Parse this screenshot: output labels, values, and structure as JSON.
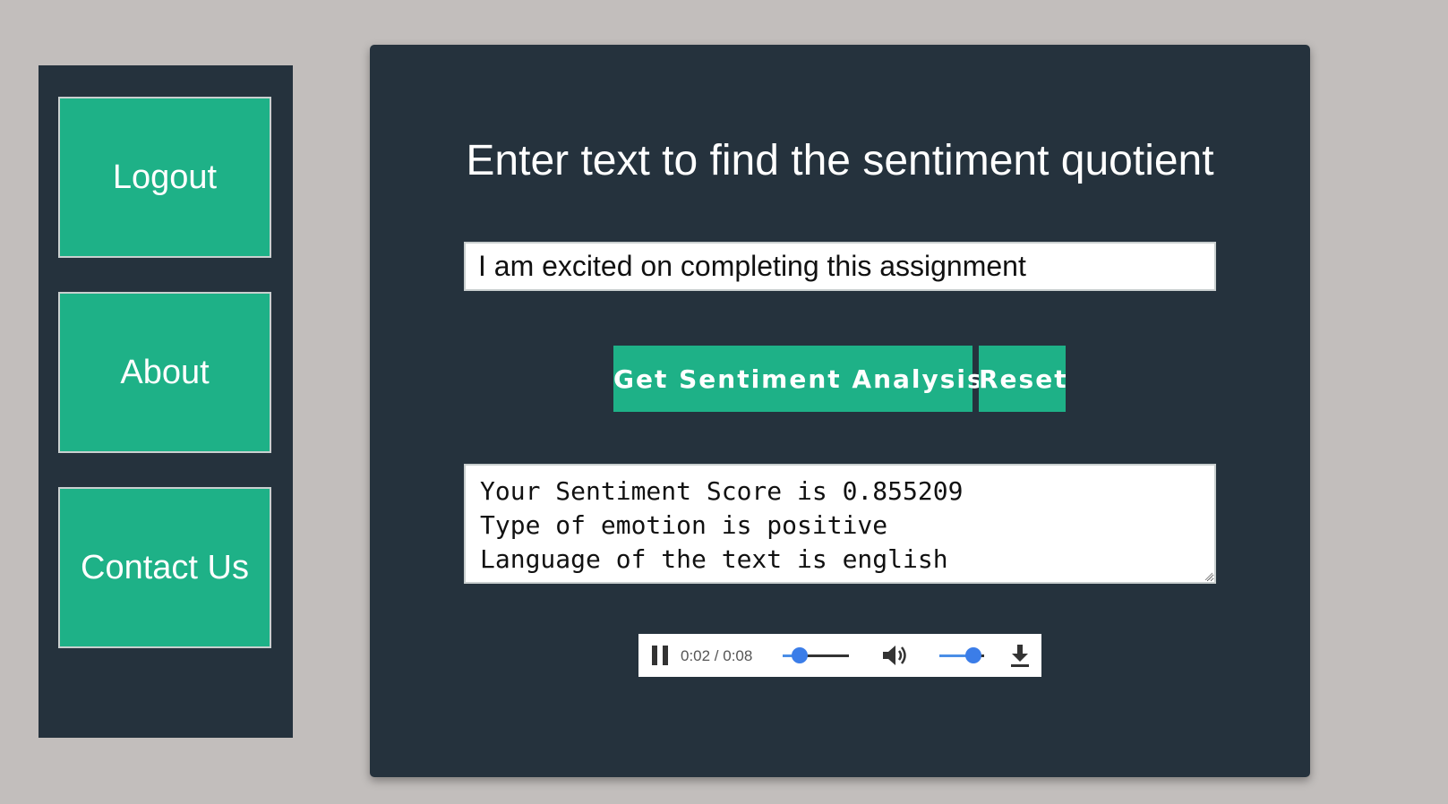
{
  "sidebar": {
    "items": [
      {
        "label": "Logout"
      },
      {
        "label": "About"
      },
      {
        "label": "Contact Us"
      }
    ]
  },
  "main": {
    "title": "Enter text to find the sentiment quotient",
    "input": {
      "value": "I am excited on completing this assignment",
      "placeholder": ""
    },
    "buttons": {
      "analyze_label": "Get Sentiment Analysis",
      "reset_label": "Reset"
    },
    "result": {
      "lines": [
        "Your Sentiment Score is 0.855209",
        "Type of emotion is positive",
        "Language of the text is english"
      ]
    },
    "audio": {
      "time": "0:02 / 0:08",
      "progress_fraction": 0.25,
      "volume_fraction": 0.75,
      "icons": {
        "play_state": "pause-icon",
        "volume": "speaker-icon",
        "download": "download-icon"
      }
    }
  },
  "colors": {
    "page_background": "#c2bebc",
    "panel_background": "#25323d",
    "accent_green": "#1eb187",
    "slider_blue": "#3b7de8"
  }
}
